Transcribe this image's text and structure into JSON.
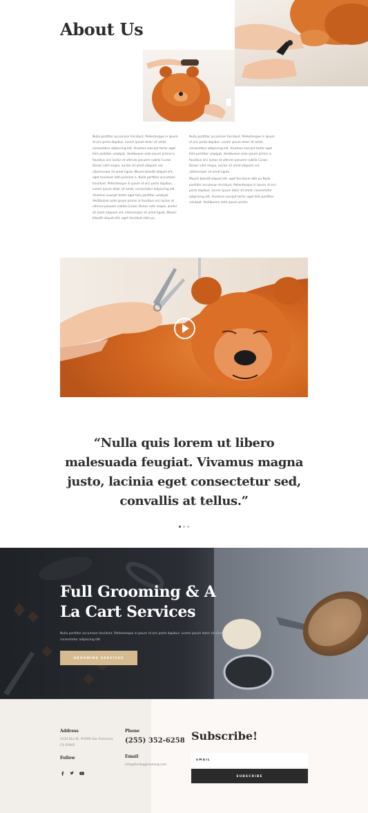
{
  "about": {
    "title": "About Us",
    "col_left": [
      "Nulla porttitor accumsan tincidunt. Pellentesque in ipsum id orci porta dapibus. Lorem ipsum dolor sit amet, consectetur adipiscing elit. Vivamus suscipit tortor eget felis porttitor volutpat. Vestibulum ante ipsum primis in faucibus orci luctus et ultrices posuere cubilia Curae; Donec velit neque, auctor sit amet aliquam vel, ullamcorper sit amet ligula. Mauris blandit aliquet elit, eget tincidunt nibh pulvinar a. Nulla porttitor accumsan tincidunt. Pellentesque in ipsum id orci porta dapibus. Lorem ipsum dolor sit amet, consectetur adipiscing elit. Vivamus suscipit tortor eget felis porttitor volutpat. Vestibulum ante ipsum primis in faucibus orci luctus et ultrices posuere cubilia Curae; Donec velit neque, auctor sit amet aliquam vel, ullamcorper sit amet ligula. Mauris blandit aliquet elit, eget tincidunt nibh pu."
    ],
    "col_right": [
      "Nulla porttitor accumsan tincidunt. Pellentesque in ipsum id orci porta dapibus. Lorem ipsum dolor sit amet, consectetur adipiscing elit. Vivamus suscipit tortor eget felis porttitor volutpat. Vestibulum ante ipsum primis in faucibus orci luctus et ultrices posuere cubilia Curae; Donec velit neque, auctor sit amet aliquam vel, ullamcorper sit amet ligula.",
      "Mauris blandit aliquet elit, eget tincidunt nibh pu Nulla porttitor accumsan tincidunt. Pellentesque in ipsum id orci porta dapibus. Lorem ipsum dolor sit amet, consectetur adipiscing elit. Vivamus suscipit tortor eget felis porttitor volutpat. Vestibulum ante ipsum primis."
    ]
  },
  "quote": {
    "text": "“Nulla quis lorem ut libero malesuada feugiat. Vivamus magna justo, lacinia eget consectetur sed, convallis at tellus.”"
  },
  "services": {
    "title": "Full Grooming & A La Cart Services",
    "text": "Nulla porttitor accumsan tincidunt. Pellentesque in ipsum id orci porta dapibus. Lorem ipsum dolor sit amet, consectetur adipiscing elit.",
    "button_label": "GROOMING SERVICES"
  },
  "footer": {
    "address_label": "Address",
    "address_value": "1234 Divi St. #1000 San Francisco, CA 93945",
    "phone_label": "Phone",
    "phone_value": "(255) 352-6258",
    "email_label": "Email",
    "email_value": "info@dividoggrooming.com",
    "follow_label": "Follow",
    "social_icons": [
      "facebook-icon",
      "twitter-icon",
      "youtube-icon"
    ],
    "subscribe_title": "Subscribe!",
    "email_placeholder": "EMAIL",
    "subscribe_button": "SUBSCRIBE"
  },
  "colors": {
    "accent": "#d6bb91",
    "dark": "#2b2b2b",
    "dog_orange": "#d96a24"
  }
}
